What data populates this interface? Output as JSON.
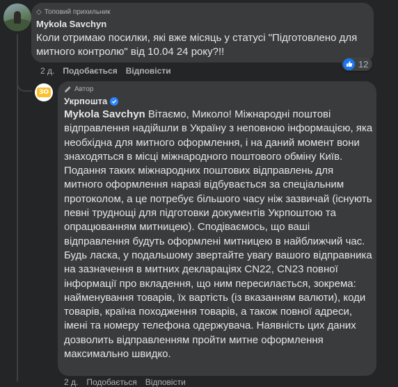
{
  "colors": {
    "background": "#242526",
    "bubble": "#3a3b3c",
    "text": "#e4e6eb",
    "secondary_text": "#b0b3b8",
    "like_blue": "#1877f2",
    "verified_blue": "#2d88ff",
    "ukrposhta_yellow": "#fbc02d"
  },
  "comment": {
    "badge": "Топовий прихильник",
    "badge_icon": "diamond-icon",
    "author": "Mykola Savchyn",
    "text": "Коли отримаю посилки, які вже місяць у статусі \"Підготовлено для митного контролю\" від 10.04 24 року?!!",
    "time": "2 д.",
    "like_label": "Подобається",
    "reply_label": "Відповісти",
    "reaction_icon": "thumbs-up-icon",
    "reaction_count": "12"
  },
  "reply": {
    "badge": "Автор",
    "badge_icon": "pencil-icon",
    "author": "Укрпошта",
    "verified_icon": "verified-check-icon",
    "avatar_text": "ЗО",
    "mention": "Mykola Savchyn",
    "text": " Вітаємо, Миколо! Міжнародні поштові відправлення надійшли в Україну з неповною інформацією, яка необхідна для митного оформлення, і на даний момент вони знаходяться в місці міжнародного поштового обміну Київ. Подання таких міжнародних поштових відправлень для митного оформлення наразі відбувається за спеціальним протоколом, а це потребує більшого часу ніж зазвичай (існують певні труднощі для підготовки документів Укрпоштою та опрацюванням митницею). Сподіваємось, що ваші відправлення будуть оформлені митницею в найближчий час. Будь ласка, у подальшому звертайте увагу вашого відправника на зазначення в митних деклараціях CN22, CN23 повної інформації про вкладення, що ним пересилається, зокрема: найменування товарів, їх вартість (із вказанням валюти), коди товарів, країна походження товарів, а також повної адреси, імені та номеру телефона одержувача. Наявність цих даних дозволить відправленням пройти митне оформлення максимально швидко.",
    "time": "2 д.",
    "like_label": "Подобається",
    "reply_label": "Відповісти"
  }
}
